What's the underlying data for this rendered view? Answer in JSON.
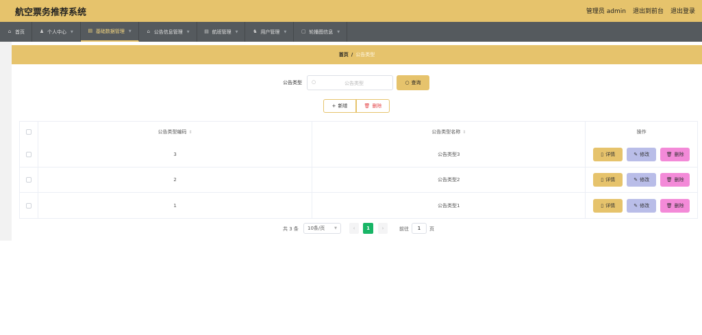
{
  "header": {
    "title": "航空票务推荐系统",
    "role_label": "管理员 admin",
    "to_front_label": "退出到前台",
    "logout_label": "退出登录"
  },
  "nav": {
    "items": [
      {
        "label": "首页",
        "icon": "home-icon",
        "has_dropdown": false
      },
      {
        "label": "个人中心",
        "icon": "user-icon",
        "has_dropdown": true
      },
      {
        "label": "基础数据管理",
        "icon": "table-icon",
        "has_dropdown": true,
        "active": true
      },
      {
        "label": "公告信息管理",
        "icon": "bank-icon",
        "has_dropdown": true
      },
      {
        "label": "航班管理",
        "icon": "table-icon",
        "has_dropdown": true
      },
      {
        "label": "用户管理",
        "icon": "user-group-icon",
        "has_dropdown": true
      },
      {
        "label": "轮播图信息",
        "icon": "image-icon",
        "has_dropdown": true
      }
    ]
  },
  "breadcrumb": {
    "home": "首页",
    "separator": "/",
    "current": "公告类型"
  },
  "search": {
    "label": "公告类型",
    "placeholder": "公告类型",
    "button_label": "查询"
  },
  "actions": {
    "add_label": "新增",
    "delete_label": "删除"
  },
  "table": {
    "columns": [
      "公告类型编码",
      "公告类型名称",
      "操作"
    ],
    "rows": [
      {
        "code": "3",
        "name": "公告类型3"
      },
      {
        "code": "2",
        "name": "公告类型2"
      },
      {
        "code": "1",
        "name": "公告类型1"
      }
    ],
    "row_actions": {
      "detail": "详情",
      "edit": "修改",
      "delete": "删除"
    }
  },
  "pagination": {
    "total_text": "共 3 条",
    "page_size_text": "10条/页",
    "current_page": "1",
    "goto_label": "前往",
    "goto_value": "1",
    "page_suffix": "页"
  },
  "colors": {
    "accent": "#e6c36c",
    "nav_bg": "#555a5e",
    "edit_button": "#b9bde8",
    "delete_button": "#f38ad8",
    "pager_active": "#18b566"
  }
}
